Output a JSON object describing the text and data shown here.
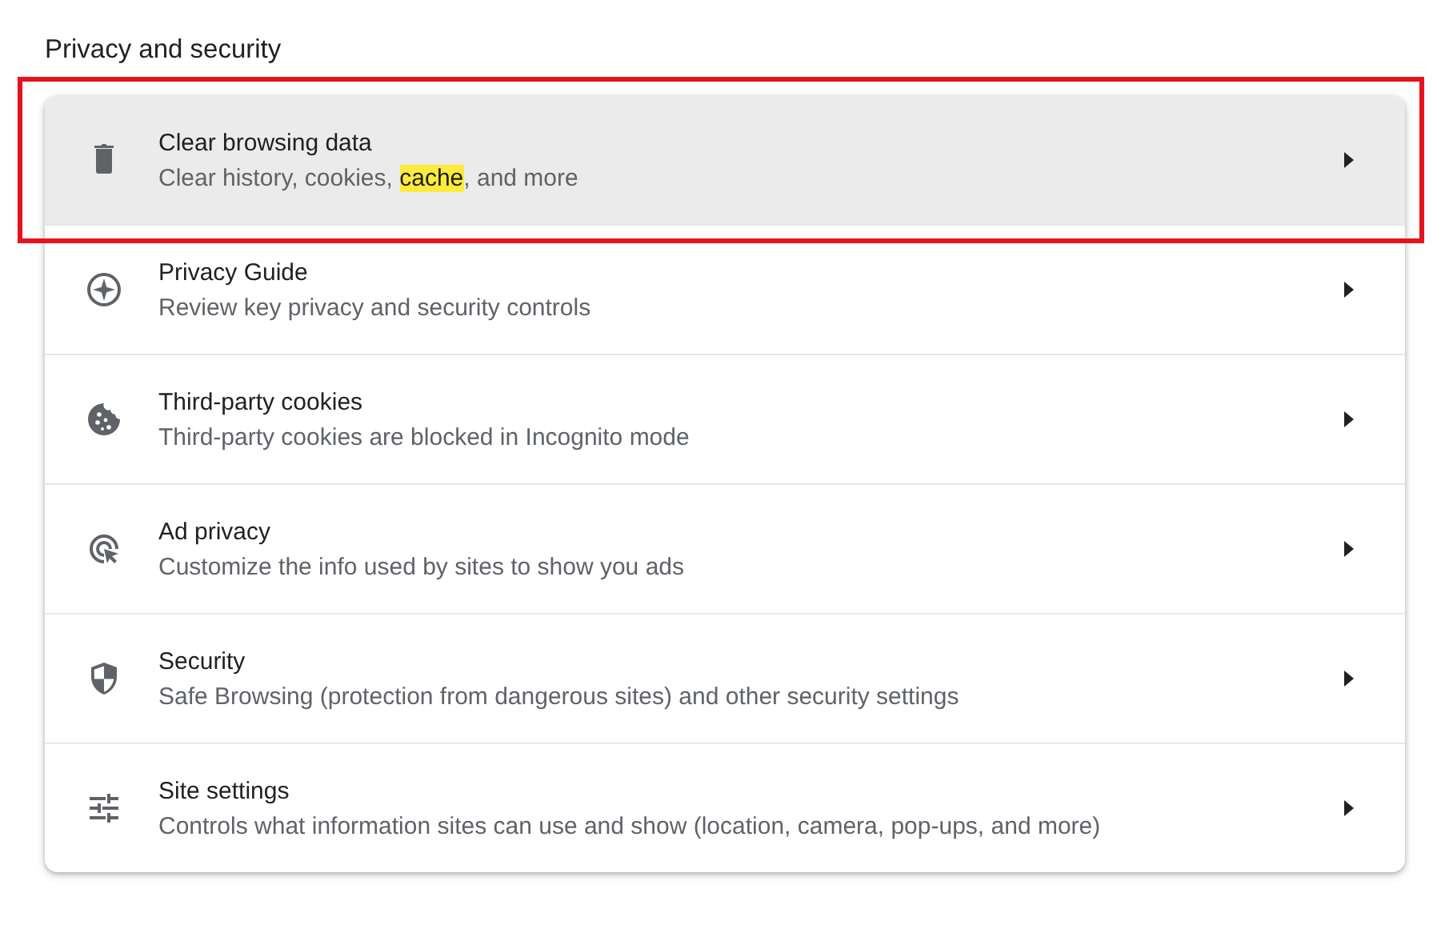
{
  "section_title": "Privacy and security",
  "items": [
    {
      "kind": "trash",
      "title": "Clear browsing data",
      "subtitle": [
        {
          "text": "Clear history, cookies, ",
          "highlighted": false
        },
        {
          "text": "cache",
          "highlighted": true
        },
        {
          "text": ", and more",
          "highlighted": false
        }
      ],
      "hovered": true,
      "outlined": true
    },
    {
      "kind": "compass",
      "title": "Privacy Guide",
      "subtitle": [
        {
          "text": "Review key privacy and security controls",
          "highlighted": false
        }
      ],
      "hovered": false,
      "outlined": false
    },
    {
      "kind": "cookie",
      "title": "Third-party cookies",
      "subtitle": [
        {
          "text": "Third-party cookies are blocked in Incognito mode",
          "highlighted": false
        }
      ],
      "hovered": false,
      "outlined": false
    },
    {
      "kind": "cursor",
      "title": "Ad privacy",
      "subtitle": [
        {
          "text": "Customize the info used by sites to show you ads",
          "highlighted": false
        }
      ],
      "hovered": false,
      "outlined": false
    },
    {
      "kind": "shield",
      "title": "Security",
      "subtitle": [
        {
          "text": "Safe Browsing (protection from dangerous sites) and other security settings",
          "highlighted": false
        }
      ],
      "hovered": false,
      "outlined": false
    },
    {
      "kind": "sliders",
      "title": "Site settings",
      "subtitle": [
        {
          "text": "Controls what information sites can use and show (location, camera, pop-ups, and more)",
          "highlighted": false
        }
      ],
      "hovered": false,
      "outlined": false
    }
  ]
}
